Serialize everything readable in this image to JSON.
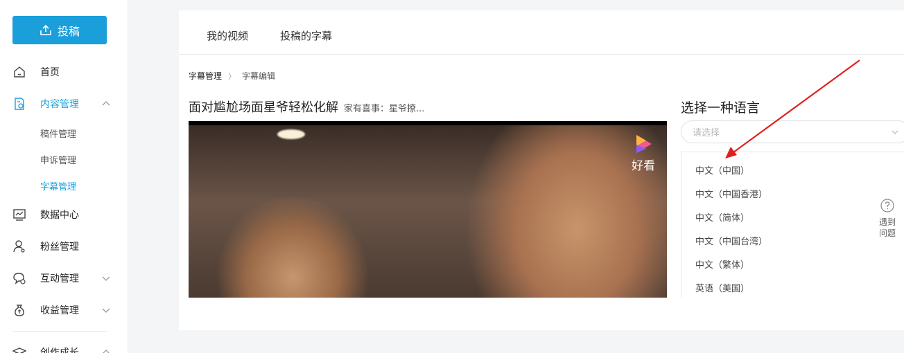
{
  "sidebar": {
    "upload_label": "投稿",
    "items": [
      {
        "label": "首页"
      },
      {
        "label": "内容管理"
      },
      {
        "label": "数据中心"
      },
      {
        "label": "粉丝管理"
      },
      {
        "label": "互动管理"
      },
      {
        "label": "收益管理"
      },
      {
        "label": "创作成长"
      }
    ],
    "subitems": [
      {
        "label": "稿件管理"
      },
      {
        "label": "申诉管理"
      },
      {
        "label": "字幕管理"
      }
    ],
    "accent_color": "#1a9fdb"
  },
  "tabs": [
    {
      "label": "我的视频"
    },
    {
      "label": "投稿的字幕"
    }
  ],
  "breadcrumb": {
    "parent": "字幕管理",
    "current": "字幕编辑"
  },
  "video": {
    "title": "面对尴尬场面星爷轻松化解",
    "subtitle": "家有喜事：星爷撩...",
    "watermark": "好看"
  },
  "language": {
    "heading": "选择一种语言",
    "placeholder": "请选择",
    "options": [
      {
        "label": "中文（中国）"
      },
      {
        "label": "中文（中国香港）"
      },
      {
        "label": "中文（简体）"
      },
      {
        "label": "中文（中国台湾）"
      },
      {
        "label": "中文（繁体）"
      },
      {
        "label": "英语（美国）"
      }
    ]
  },
  "help": {
    "line1": "遇到",
    "line2": "问题"
  }
}
